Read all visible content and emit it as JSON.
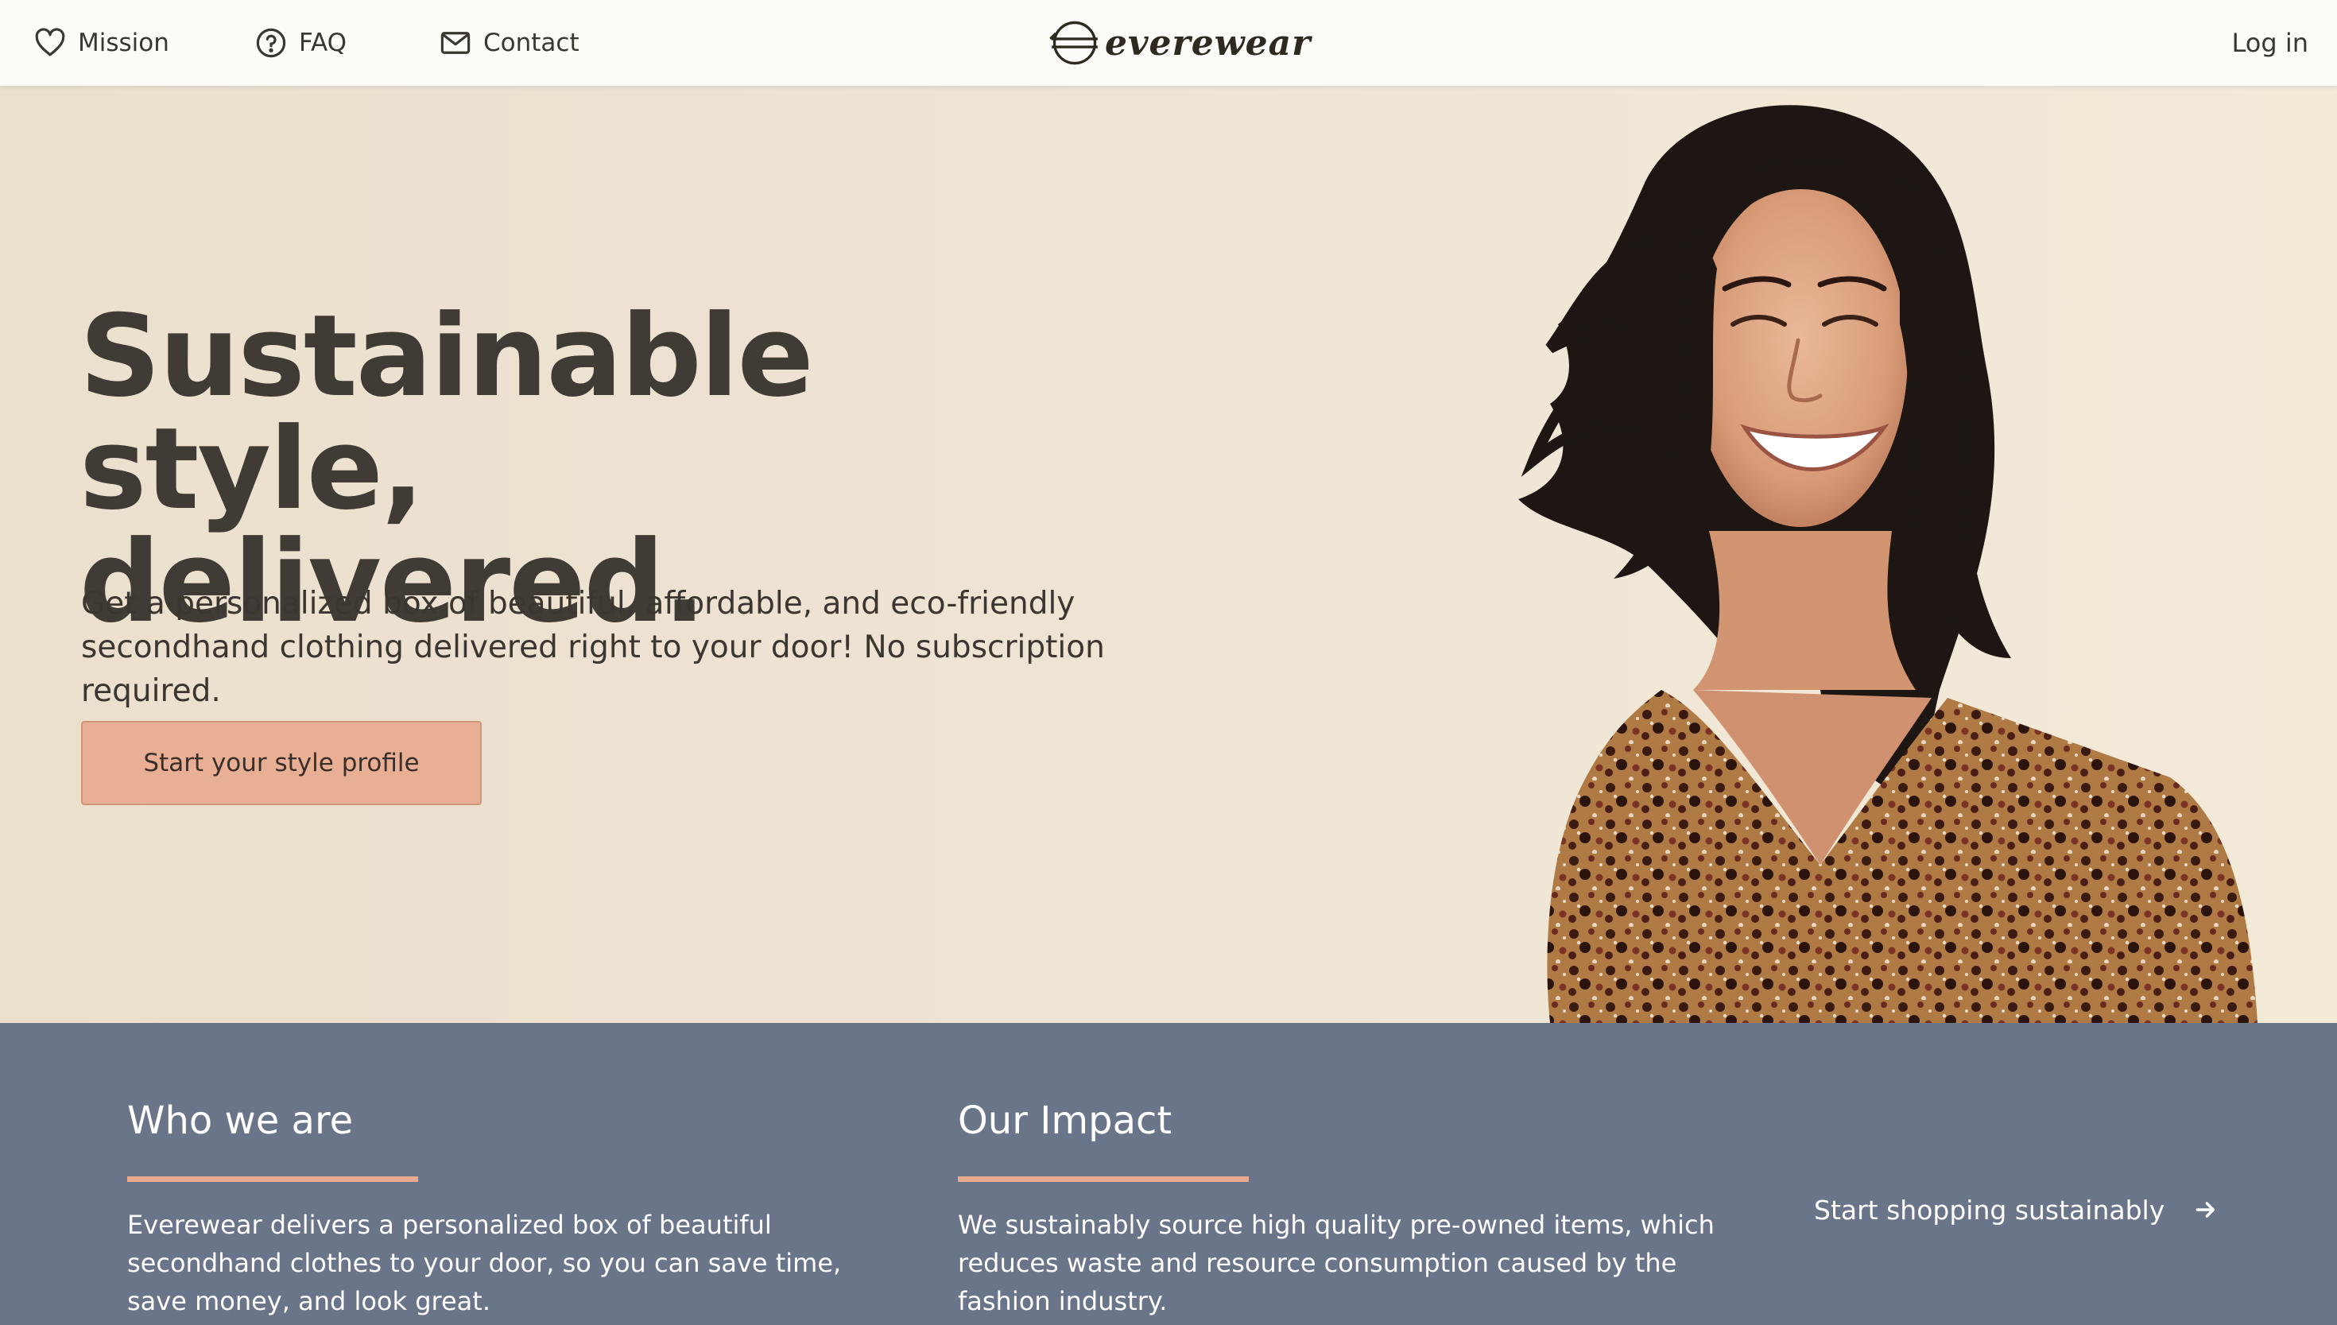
{
  "nav": {
    "mission_label": "Mission",
    "faq_label": "FAQ",
    "contact_label": "Contact",
    "brand": "everewear",
    "login_label": "Log in"
  },
  "hero": {
    "title_line1": "Sustainable style,",
    "title_line2": "delivered.",
    "subtitle": "Get a personalized box of beautiful, affordable, and eco-friendly secondhand clothing delivered right to your door! No subscription required.",
    "cta_label": "Start your style profile"
  },
  "about": {
    "who_title": "Who we are",
    "who_text": "Everewear delivers a personalized box of beautiful secondhand clothes to your door, so you can save time, save money, and look great.",
    "impact_title": "Our Impact",
    "impact_text": "We sustainably source high quality pre-owned items, which reduces waste and resource consumption caused by the fashion industry.",
    "shop_link_label": "Start shopping sustainably"
  },
  "colors": {
    "nav_bg": "#fdfbf7",
    "hero_bg": "#ede2d0",
    "cta_bg": "#e9af95",
    "band_bg": "#6b7589",
    "accent_rule": "#e9ab8f"
  },
  "icons": {
    "mission": "heart-icon",
    "faq": "question-circle-icon",
    "contact": "envelope-icon",
    "logo": "globe-logo-icon",
    "shop": "arrow-right-icon"
  }
}
